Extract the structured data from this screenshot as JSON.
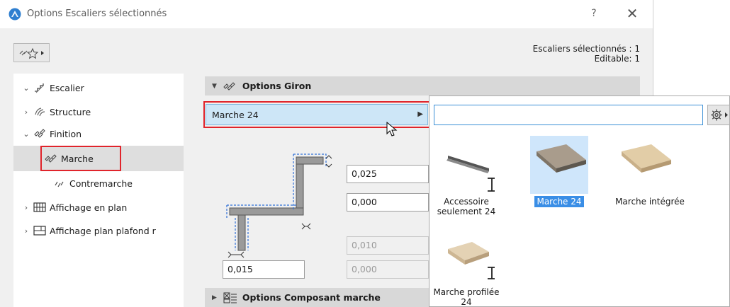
{
  "window": {
    "title": "Options Escaliers sélectionnés",
    "help_label": "?",
    "close_label": "✕"
  },
  "status": {
    "selected": "Escaliers sélectionnés : 1",
    "editable": "Editable: 1"
  },
  "tree": {
    "items": [
      {
        "label": "Escalier",
        "expanded": true
      },
      {
        "label": "Structure",
        "expanded": false
      },
      {
        "label": "Finition",
        "expanded": true
      },
      {
        "label": "Marche",
        "selected": true
      },
      {
        "label": "Contremarche"
      },
      {
        "label": "Affichage en plan",
        "expanded": false
      },
      {
        "label": "Affichage plan plafond r",
        "expanded": false
      }
    ]
  },
  "panel": {
    "section_title": "Options Giron",
    "picker_value": "Marche 24",
    "fields": {
      "top_offset": "0,025",
      "nosing": "0,000",
      "disabled_1": "0,010",
      "thickness": "0,015",
      "disabled_2": "0,000"
    },
    "section2_title": "Options Composant marche"
  },
  "popup": {
    "search_value": "",
    "items": [
      {
        "label": "Accessoire seulement 24",
        "selected": false
      },
      {
        "label": "Marche 24",
        "selected": true
      },
      {
        "label": "Marche intégrée",
        "selected": false
      },
      {
        "label": "Marche profilée 24",
        "selected": false
      }
    ]
  },
  "colors": {
    "highlight_red": "#e0242b",
    "selection_blue": "#3a8ee6",
    "picker_bg": "#cde6f7"
  }
}
